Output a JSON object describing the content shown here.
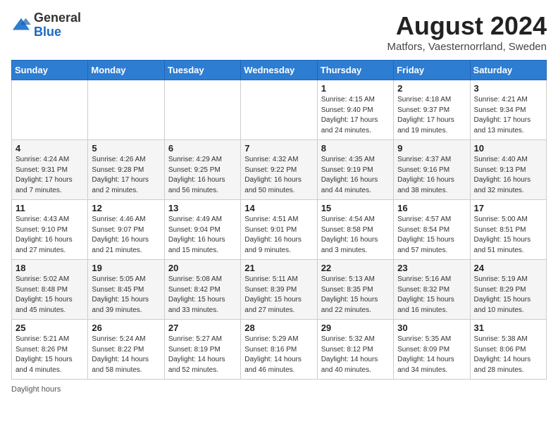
{
  "header": {
    "logo": {
      "general": "General",
      "blue": "Blue"
    },
    "title": "August 2024",
    "location": "Matfors, Vaesternorrland, Sweden"
  },
  "days_of_week": [
    "Sunday",
    "Monday",
    "Tuesday",
    "Wednesday",
    "Thursday",
    "Friday",
    "Saturday"
  ],
  "weeks": [
    [
      {
        "day": "",
        "sunrise": "",
        "sunset": "",
        "daylight": ""
      },
      {
        "day": "",
        "sunrise": "",
        "sunset": "",
        "daylight": ""
      },
      {
        "day": "",
        "sunrise": "",
        "sunset": "",
        "daylight": ""
      },
      {
        "day": "",
        "sunrise": "",
        "sunset": "",
        "daylight": ""
      },
      {
        "day": "1",
        "sunrise": "Sunrise: 4:15 AM",
        "sunset": "Sunset: 9:40 PM",
        "daylight": "Daylight: 17 hours and 24 minutes."
      },
      {
        "day": "2",
        "sunrise": "Sunrise: 4:18 AM",
        "sunset": "Sunset: 9:37 PM",
        "daylight": "Daylight: 17 hours and 19 minutes."
      },
      {
        "day": "3",
        "sunrise": "Sunrise: 4:21 AM",
        "sunset": "Sunset: 9:34 PM",
        "daylight": "Daylight: 17 hours and 13 minutes."
      }
    ],
    [
      {
        "day": "4",
        "sunrise": "Sunrise: 4:24 AM",
        "sunset": "Sunset: 9:31 PM",
        "daylight": "Daylight: 17 hours and 7 minutes."
      },
      {
        "day": "5",
        "sunrise": "Sunrise: 4:26 AM",
        "sunset": "Sunset: 9:28 PM",
        "daylight": "Daylight: 17 hours and 2 minutes."
      },
      {
        "day": "6",
        "sunrise": "Sunrise: 4:29 AM",
        "sunset": "Sunset: 9:25 PM",
        "daylight": "Daylight: 16 hours and 56 minutes."
      },
      {
        "day": "7",
        "sunrise": "Sunrise: 4:32 AM",
        "sunset": "Sunset: 9:22 PM",
        "daylight": "Daylight: 16 hours and 50 minutes."
      },
      {
        "day": "8",
        "sunrise": "Sunrise: 4:35 AM",
        "sunset": "Sunset: 9:19 PM",
        "daylight": "Daylight: 16 hours and 44 minutes."
      },
      {
        "day": "9",
        "sunrise": "Sunrise: 4:37 AM",
        "sunset": "Sunset: 9:16 PM",
        "daylight": "Daylight: 16 hours and 38 minutes."
      },
      {
        "day": "10",
        "sunrise": "Sunrise: 4:40 AM",
        "sunset": "Sunset: 9:13 PM",
        "daylight": "Daylight: 16 hours and 32 minutes."
      }
    ],
    [
      {
        "day": "11",
        "sunrise": "Sunrise: 4:43 AM",
        "sunset": "Sunset: 9:10 PM",
        "daylight": "Daylight: 16 hours and 27 minutes."
      },
      {
        "day": "12",
        "sunrise": "Sunrise: 4:46 AM",
        "sunset": "Sunset: 9:07 PM",
        "daylight": "Daylight: 16 hours and 21 minutes."
      },
      {
        "day": "13",
        "sunrise": "Sunrise: 4:49 AM",
        "sunset": "Sunset: 9:04 PM",
        "daylight": "Daylight: 16 hours and 15 minutes."
      },
      {
        "day": "14",
        "sunrise": "Sunrise: 4:51 AM",
        "sunset": "Sunset: 9:01 PM",
        "daylight": "Daylight: 16 hours and 9 minutes."
      },
      {
        "day": "15",
        "sunrise": "Sunrise: 4:54 AM",
        "sunset": "Sunset: 8:58 PM",
        "daylight": "Daylight: 16 hours and 3 minutes."
      },
      {
        "day": "16",
        "sunrise": "Sunrise: 4:57 AM",
        "sunset": "Sunset: 8:54 PM",
        "daylight": "Daylight: 15 hours and 57 minutes."
      },
      {
        "day": "17",
        "sunrise": "Sunrise: 5:00 AM",
        "sunset": "Sunset: 8:51 PM",
        "daylight": "Daylight: 15 hours and 51 minutes."
      }
    ],
    [
      {
        "day": "18",
        "sunrise": "Sunrise: 5:02 AM",
        "sunset": "Sunset: 8:48 PM",
        "daylight": "Daylight: 15 hours and 45 minutes."
      },
      {
        "day": "19",
        "sunrise": "Sunrise: 5:05 AM",
        "sunset": "Sunset: 8:45 PM",
        "daylight": "Daylight: 15 hours and 39 minutes."
      },
      {
        "day": "20",
        "sunrise": "Sunrise: 5:08 AM",
        "sunset": "Sunset: 8:42 PM",
        "daylight": "Daylight: 15 hours and 33 minutes."
      },
      {
        "day": "21",
        "sunrise": "Sunrise: 5:11 AM",
        "sunset": "Sunset: 8:39 PM",
        "daylight": "Daylight: 15 hours and 27 minutes."
      },
      {
        "day": "22",
        "sunrise": "Sunrise: 5:13 AM",
        "sunset": "Sunset: 8:35 PM",
        "daylight": "Daylight: 15 hours and 22 minutes."
      },
      {
        "day": "23",
        "sunrise": "Sunrise: 5:16 AM",
        "sunset": "Sunset: 8:32 PM",
        "daylight": "Daylight: 15 hours and 16 minutes."
      },
      {
        "day": "24",
        "sunrise": "Sunrise: 5:19 AM",
        "sunset": "Sunset: 8:29 PM",
        "daylight": "Daylight: 15 hours and 10 minutes."
      }
    ],
    [
      {
        "day": "25",
        "sunrise": "Sunrise: 5:21 AM",
        "sunset": "Sunset: 8:26 PM",
        "daylight": "Daylight: 15 hours and 4 minutes."
      },
      {
        "day": "26",
        "sunrise": "Sunrise: 5:24 AM",
        "sunset": "Sunset: 8:22 PM",
        "daylight": "Daylight: 14 hours and 58 minutes."
      },
      {
        "day": "27",
        "sunrise": "Sunrise: 5:27 AM",
        "sunset": "Sunset: 8:19 PM",
        "daylight": "Daylight: 14 hours and 52 minutes."
      },
      {
        "day": "28",
        "sunrise": "Sunrise: 5:29 AM",
        "sunset": "Sunset: 8:16 PM",
        "daylight": "Daylight: 14 hours and 46 minutes."
      },
      {
        "day": "29",
        "sunrise": "Sunrise: 5:32 AM",
        "sunset": "Sunset: 8:12 PM",
        "daylight": "Daylight: 14 hours and 40 minutes."
      },
      {
        "day": "30",
        "sunrise": "Sunrise: 5:35 AM",
        "sunset": "Sunset: 8:09 PM",
        "daylight": "Daylight: 14 hours and 34 minutes."
      },
      {
        "day": "31",
        "sunrise": "Sunrise: 5:38 AM",
        "sunset": "Sunset: 8:06 PM",
        "daylight": "Daylight: 14 hours and 28 minutes."
      }
    ]
  ],
  "footer": {
    "daylight_label": "Daylight hours"
  }
}
